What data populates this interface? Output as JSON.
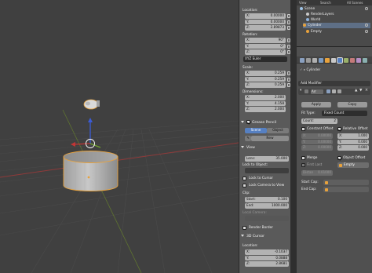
{
  "outliner": {
    "tabs": [
      "View",
      "Search",
      "All Scenes"
    ],
    "rows": [
      {
        "label": "Scene",
        "indent": 0
      },
      {
        "label": "RenderLayers",
        "indent": 1
      },
      {
        "label": "World",
        "indent": 1
      },
      {
        "label": "Cylinder",
        "indent": 1
      },
      {
        "label": "Empty",
        "indent": 1
      }
    ]
  },
  "npanel": {
    "location_label": "Location:",
    "location": [
      {
        "axis": "X:",
        "value": "0.00000"
      },
      {
        "axis": "Y:",
        "value": "0.00000"
      },
      {
        "axis": "Z:",
        "value": "2.89873"
      }
    ],
    "rotation_label": "Rotation:",
    "rotation": [
      {
        "axis": "X:",
        "value": "90°"
      },
      {
        "axis": "Y:",
        "value": "0°"
      },
      {
        "axis": "Z:",
        "value": "0°"
      }
    ],
    "rotation_mode": "XYZ Euler",
    "scale_label": "Scale:",
    "scale": [
      {
        "axis": "X:",
        "value": "0.259"
      },
      {
        "axis": "Y:",
        "value": "0.259"
      },
      {
        "axis": "Z:",
        "value": "0.259"
      }
    ],
    "dimensions_label": "Dimensions:",
    "dimensions": [
      {
        "axis": "X:",
        "value": "2.000"
      },
      {
        "axis": "Y:",
        "value": "4.158"
      },
      {
        "axis": "Z:",
        "value": "2.000"
      }
    ],
    "grease_pencil_label": "Grease Pencil",
    "scene_btn": "Scene",
    "object_btn": "Object",
    "new_btn": "New",
    "view_label": "View",
    "lens_label": "Lens:",
    "lens_value": "35.000",
    "lock_to_object": "Lock to Object:",
    "lock_to_cursor": "Lock to Cursor",
    "lock_camera_to_view": "Lock Camera to View",
    "clip_label": "Clip:",
    "clip_start_label": "Start:",
    "clip_start": "0.100",
    "clip_end_label": "End:",
    "clip_end": "1000.000",
    "local_camera": "Local Camera:",
    "render_border": "Render Border",
    "cursor_label": "3D Cursor",
    "cursor_location_label": "Location:",
    "cursor_location": [
      {
        "axis": "X:",
        "value": "-0.1037"
      },
      {
        "axis": "Y:",
        "value": "0.0888"
      },
      {
        "axis": "Z:",
        "value": "2.8681"
      }
    ]
  },
  "properties": {
    "object_name": "Cylinder",
    "add_modifier": "Add Modifier",
    "modifier_name": "Arr",
    "apply_btn": "Apply",
    "copy_btn": "Copy",
    "fit_type_label": "Fit Type:",
    "fit_type": "Fixed Count",
    "count_label": "Count:",
    "count_value": "2",
    "constant_offset": "Constant Offset",
    "relative_offset": "Relative Offset",
    "offsets_left": [
      {
        "axis": "X:",
        "value": "0.00000"
      },
      {
        "axis": "Y:",
        "value": "0.00000"
      },
      {
        "axis": "Z:",
        "value": "0.00000"
      }
    ],
    "offsets_right": [
      {
        "axis": "X:",
        "value": "1.000"
      },
      {
        "axis": "Y:",
        "value": "0.000"
      },
      {
        "axis": "Z:",
        "value": "0.000"
      }
    ],
    "merge_label": "Merge",
    "object_offset": "Object Offset",
    "first_last": "First Last",
    "offset_object": "Empty",
    "distance_label": "Distan",
    "distance_value": "0.01000",
    "start_cap": "Start Cap:",
    "end_cap": "End Cap:"
  },
  "colors": {
    "viewport_bg": "#404040",
    "selection_orange": "#e8a23c",
    "active_blue": "#5680c2",
    "axis_red": "#b23a3a",
    "axis_green": "#7a9a2e"
  }
}
